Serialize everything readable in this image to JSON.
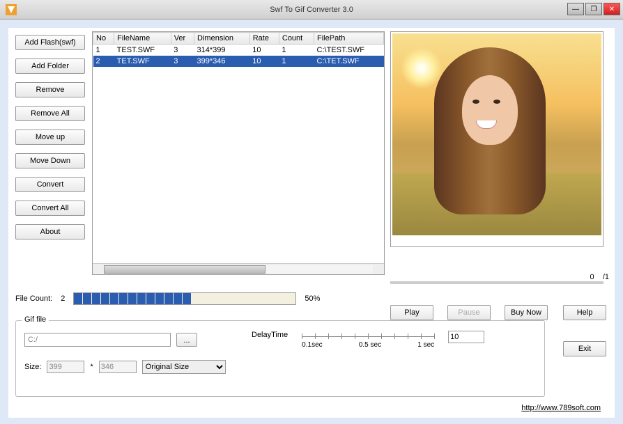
{
  "window": {
    "title": "Swf To Gif Converter 3.0"
  },
  "sidebar": {
    "add_flash": "Add Flash(swf)",
    "add_folder": "Add Folder",
    "remove": "Remove",
    "remove_all": "Remove All",
    "move_up": "Move up",
    "move_down": "Move Down",
    "convert": "Convert",
    "convert_all": "Convert All",
    "about": "About"
  },
  "table": {
    "headers": {
      "no": "No",
      "filename": "FileName",
      "ver": "Ver",
      "dimension": "Dimension",
      "rate": "Rate",
      "count": "Count",
      "filepath": "FilePath"
    },
    "rows": [
      {
        "no": "1",
        "filename": "TEST.SWF",
        "ver": "3",
        "dimension": "314*399",
        "rate": "10",
        "count": "1",
        "filepath": "C:\\TEST.SWF"
      },
      {
        "no": "2",
        "filename": "TET.SWF",
        "ver": "3",
        "dimension": "399*346",
        "rate": "10",
        "count": "1",
        "filepath": "C:\\TET.SWF"
      }
    ]
  },
  "preview_pos": {
    "current": "0",
    "total": "/1"
  },
  "file_count": {
    "label": "File Count:",
    "value": "2",
    "percent": "50%"
  },
  "controls": {
    "play": "Play",
    "pause": "Pause",
    "buy_now": "Buy Now",
    "help": "Help",
    "exit": "Exit"
  },
  "gif": {
    "legend": "Gif file",
    "path": "C:/",
    "browse": "...",
    "delay_label": "DelayTime",
    "delay_value": "10",
    "delay_ticks": {
      "min": "0.1sec",
      "mid": "0.5 sec",
      "max": "1 sec"
    },
    "size_label": "Size:",
    "width": "399",
    "height": "346",
    "mult": "*",
    "mode": "Original Size"
  },
  "footer": {
    "link": "http://www.789soft.com"
  }
}
